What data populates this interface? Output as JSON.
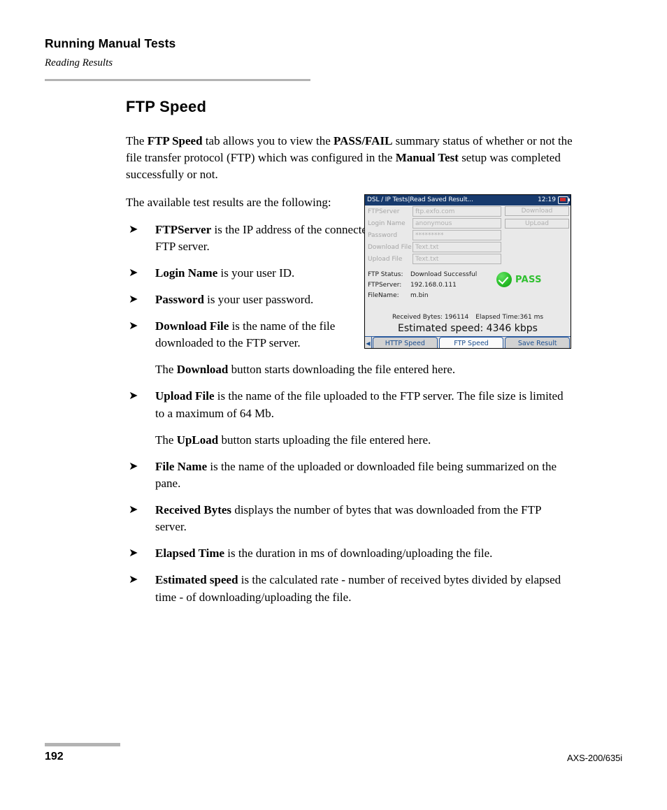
{
  "header": {
    "chapter_title": "Running Manual Tests",
    "section_subtitle": "Reading Results"
  },
  "main": {
    "topic_title": "FTP Speed",
    "intro_paragraph": {
      "part1": "The ",
      "bold1": "FTP Speed",
      "part2": " tab allows you to view the ",
      "bold2": "PASS/FAIL",
      "part3": " summary status of whether or not the file transfer protocol (FTP) which was configured in the ",
      "bold3": "Manual Test",
      "part4": " setup was completed successfully or not."
    },
    "available_intro": "The available test results are the following:",
    "bullet_marker": "➤",
    "bullets": [
      {
        "term": "FTPServer",
        "text": " is the IP address of the connected FTP server."
      },
      {
        "term": "Login Name",
        "text": " is your user ID."
      },
      {
        "term": "Password",
        "text": " is your user password."
      },
      {
        "term": "Download File",
        "text": " is the name of the file downloaded to the FTP server."
      },
      {
        "term": "Upload File",
        "text": " is the name of the file uploaded to the FTP server. The file size is limited to a maximum of 64 Mb."
      },
      {
        "term": "File Name",
        "text": " is the name of the uploaded or downloaded file being summarized on the pane."
      },
      {
        "term": "Received Bytes",
        "text": " displays the number of bytes that was downloaded from the FTP server."
      },
      {
        "term": "Elapsed Time",
        "text": " is the duration in ms of downloading/uploading the file."
      },
      {
        "term": "Estimated speed",
        "text": " is the calculated rate - number of received bytes divided by elapsed time - of downloading/uploading the file."
      }
    ],
    "download_note": {
      "part1": "The ",
      "bold": "Download",
      "part2": " button starts downloading the file entered here."
    },
    "upload_note": {
      "part1": "The ",
      "bold": "UpLoad",
      "part2": " button starts uploading the file entered here."
    }
  },
  "device": {
    "titlebar": {
      "title": "DSL / IP Tests|Read Saved Result...",
      "clock": "12:19",
      "battery_icon": "battery-icon"
    },
    "form_fields": [
      {
        "label": "FTPServer",
        "value": "ftp.exfo.com"
      },
      {
        "label": "Login Name",
        "value": "anonymous"
      },
      {
        "label": "Password",
        "value": "*********"
      },
      {
        "label": "Download File",
        "value": "Text.txt"
      },
      {
        "label": "Upload File",
        "value": "Text.txt"
      }
    ],
    "buttons": [
      {
        "label": "Download"
      },
      {
        "label": "UpLoad"
      }
    ],
    "status_rows": [
      {
        "key": "FTP Status:",
        "value": "Download Successful"
      },
      {
        "key": "FTPServer:",
        "value": "192.168.0.111"
      },
      {
        "key": "FileName:",
        "value": "m.bin"
      }
    ],
    "verdict": {
      "label": "PASS",
      "icon": "check-circle-icon",
      "color": "#31c031"
    },
    "summary": {
      "received_bytes": "Received Bytes: 196114",
      "elapsed_time": "Elapsed Time:361 ms",
      "estimated_speed": "Estimated speed:  4346 kbps"
    },
    "tabs": {
      "scroll_left_icon": "◀",
      "items": [
        {
          "label": "HTTP Speed",
          "active": false
        },
        {
          "label": "FTP Speed",
          "active": true
        },
        {
          "label": "Save Result",
          "active": false
        }
      ]
    }
  },
  "footer": {
    "page_number": "192",
    "model": "AXS-200/635i"
  }
}
